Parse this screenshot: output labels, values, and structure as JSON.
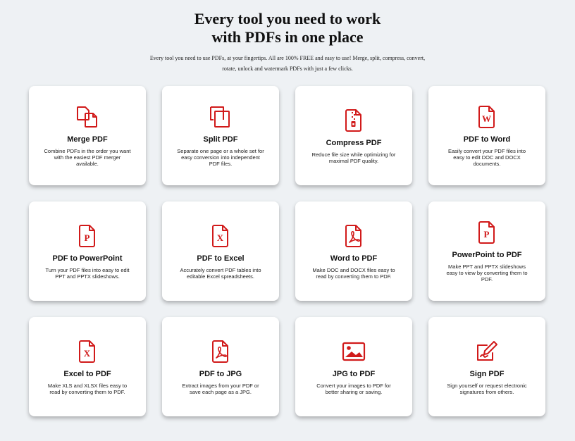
{
  "hero": {
    "title_line1": "Every tool you need to work",
    "title_line2": "with PDFs in one place",
    "subtitle": "Every tool you need to use PDFs, at your fingertips. All are 100% FREE and easy to use! Merge, split, compress, convert, rotate, unlock and watermark PDFs with just a few clicks."
  },
  "colors": {
    "accent": "#d11a1a",
    "background": "#eef1f4",
    "card": "#ffffff"
  },
  "tools": [
    {
      "title": "Merge PDF",
      "desc": "Combine PDFs in the order you want with the easiest PDF merger available.",
      "icon": "merge-icon"
    },
    {
      "title": "Split PDF",
      "desc": "Separate one page or a whole set for easy conversion into independent PDF files.",
      "icon": "split-icon"
    },
    {
      "title": "Compress PDF",
      "desc": "Reduce file size while optimizing for maximal PDF quality.",
      "icon": "compress-icon"
    },
    {
      "title": "PDF to Word",
      "desc": "Easily convert your PDF files into easy to edit DOC and DOCX documents.",
      "icon": "word-file-icon",
      "letter": "W"
    },
    {
      "title": "PDF to PowerPoint",
      "desc": "Turn your PDF files into easy to edit PPT and PPTX slideshows.",
      "icon": "powerpoint-file-icon",
      "letter": "P"
    },
    {
      "title": "PDF to Excel",
      "desc": "Accurately convert PDF tables into editable Excel spreadsheets.",
      "icon": "excel-file-icon",
      "letter": "X"
    },
    {
      "title": "Word to PDF",
      "desc": "Make DOC and DOCX files easy to read by converting them to PDF.",
      "icon": "pdf-file-icon"
    },
    {
      "title": "PowerPoint to PDF",
      "desc": "Make PPT and PPTX slideshows easy to view by converting them to PDF.",
      "icon": "powerpoint-file-icon",
      "letter": "P"
    },
    {
      "title": "Excel to PDF",
      "desc": "Make XLS and XLSX files easy to read by converting them to PDF.",
      "icon": "excel-file-icon",
      "letter": "X"
    },
    {
      "title": "PDF to JPG",
      "desc": "Extract images from your PDF or save each page as a JPG.",
      "icon": "pdf-file-icon"
    },
    {
      "title": "JPG to PDF",
      "desc": "Convert your images to PDF for better sharing or saving.",
      "icon": "image-icon"
    },
    {
      "title": "Sign PDF",
      "desc": "Sign yourself or request electronic signatures from others.",
      "icon": "sign-icon"
    }
  ]
}
